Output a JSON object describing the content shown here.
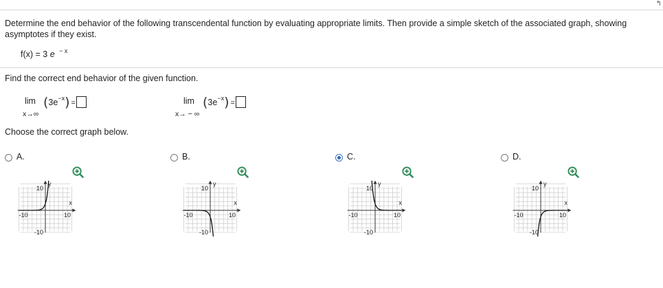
{
  "top_corner_glyph": "↰",
  "problem_text": "Determine the end behavior of the following transcendental function by evaluating appropriate limits. Then provide a simple sketch of the associated graph, showing asymptotes if they exist.",
  "function": {
    "lhs": "f(x) = 3",
    "base": "e",
    "exponent": "− x"
  },
  "find_text": "Find the correct end behavior of the given function.",
  "limits": [
    {
      "word": "lim",
      "approach": "x→∞",
      "coef": "3e",
      "exponent": "−x",
      "equals": "=",
      "answer": ""
    },
    {
      "word": "lim",
      "approach": "x→ − ∞",
      "coef": "3e",
      "exponent": "−x",
      "equals": "=",
      "answer": ""
    }
  ],
  "choose_text": "Choose the correct graph below.",
  "options": [
    {
      "letter": "A.",
      "selected": false,
      "ytick": "10",
      "yneg": "-10",
      "xneg": "-10",
      "xpos": "10",
      "ylabel": "y",
      "xlabel": "x",
      "curve": "increasing exponential (3e^x)"
    },
    {
      "letter": "B.",
      "selected": false,
      "ytick": "10",
      "yneg": "-10",
      "xneg": "-10",
      "xpos": "10",
      "ylabel": "y",
      "xlabel": "x",
      "curve": "reflected decreasing (-3e^x)"
    },
    {
      "letter": "C.",
      "selected": true,
      "ytick": "10",
      "yneg": "-10",
      "xneg": "-10",
      "xpos": "10",
      "ylabel": "y",
      "xlabel": "x",
      "curve": "decreasing exponential (3e^-x)"
    },
    {
      "letter": "D.",
      "selected": false,
      "ytick": "10",
      "yneg": "-10",
      "xneg": "-10",
      "xpos": "10",
      "ylabel": "y",
      "xlabel": "x",
      "curve": "reflected increasing (-3e^-x)"
    }
  ],
  "colors": {
    "radio_selected": "#2f63bd",
    "zoom_icon": "#2e8b57",
    "grid": "#cfcfcf",
    "curve": "#111111"
  }
}
